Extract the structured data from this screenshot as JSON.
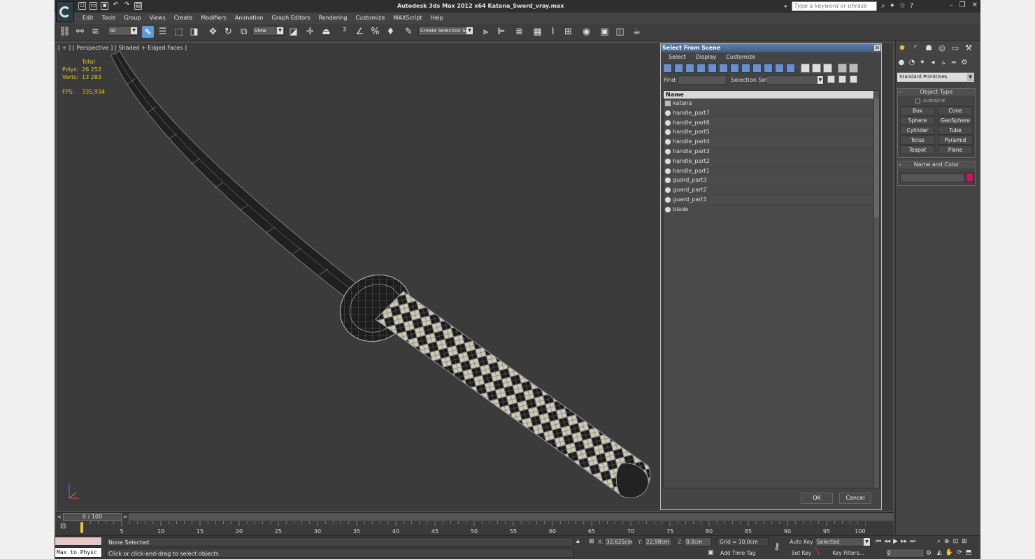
{
  "titlebar": {
    "title": "Autodesk 3ds Max  2012 x64     Katana_Sword_vray.max",
    "search_placeholder": "Type a keyword or phrase"
  },
  "menu": [
    "Edit",
    "Tools",
    "Group",
    "Views",
    "Create",
    "Modifiers",
    "Animation",
    "Graph Editors",
    "Rendering",
    "Customize",
    "MAXScript",
    "Help"
  ],
  "toolbar": {
    "filter_dropdown": "All",
    "ref_coord_dropdown": "View",
    "selection_set_dropdown": "Create Selection Se"
  },
  "viewport": {
    "label": "[ + ] [ Perspective ] [ Shaded + Edged Faces ]",
    "stats": {
      "header": "Total",
      "polys_label": "Polys:",
      "polys_value": "26 252",
      "verts_label": "Verts:",
      "verts_value": "13 283",
      "fps_label": "FPS:",
      "fps_value": "335,934"
    }
  },
  "select_dialog": {
    "title": "Select From Scene",
    "menu": [
      "Select",
      "Display",
      "Customize"
    ],
    "find_label": "Find:",
    "selection_set_label": "Selection Set:",
    "column_name": "Name",
    "items": [
      "katana",
      "handle_part7",
      "handle_part6",
      "handle_part5",
      "handle_part4",
      "handle_part3",
      "handle_part2",
      "handle_part1",
      "guard_part3",
      "guard_part2",
      "guard_part1",
      "blade"
    ],
    "ok_label": "OK",
    "cancel_label": "Cancel"
  },
  "command_panel": {
    "category_dropdown": "Standard Primitives",
    "object_type_title": "Object Type",
    "autogrid_label": "AutoGrid",
    "primitives": [
      "Box",
      "Cone",
      "Sphere",
      "GeoSphere",
      "Cylinder",
      "Tube",
      "Torus",
      "Pyramid",
      "Teapot",
      "Plane"
    ],
    "name_color_title": "Name and Color"
  },
  "timeline": {
    "slider_label": "0 / 100",
    "ticks": [
      "5",
      "10",
      "15",
      "20",
      "25",
      "30",
      "35",
      "40",
      "45",
      "50",
      "55",
      "60",
      "65",
      "70",
      "75",
      "80",
      "85",
      "90",
      "95",
      "100"
    ]
  },
  "statusbar": {
    "maxscript_text": "Max to Physc",
    "selection_status": "None Selected",
    "prompt": "Click or click-and-drag to select objects",
    "x_label": "X:",
    "x_value": "32,625cm",
    "y_label": "Y:",
    "y_value": "22,98cm",
    "z_label": "Z:",
    "z_value": "0,0cm",
    "grid": "Grid = 10,0cm",
    "add_time_tag": "Add Time Tag",
    "auto_key": "Auto Key",
    "set_key": "Set Key",
    "selected_dropdown": "Selected",
    "key_filters": "Key Filters...",
    "frame_value": "0"
  }
}
